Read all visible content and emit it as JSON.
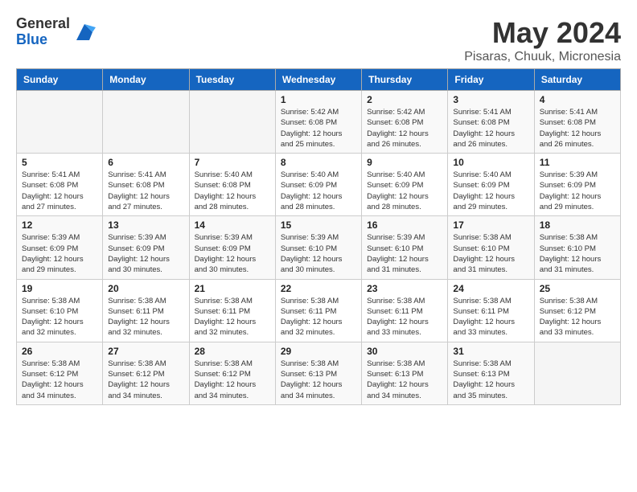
{
  "header": {
    "logo_general": "General",
    "logo_blue": "Blue",
    "month_year": "May 2024",
    "location": "Pisaras, Chuuk, Micronesia"
  },
  "weekdays": [
    "Sunday",
    "Monday",
    "Tuesday",
    "Wednesday",
    "Thursday",
    "Friday",
    "Saturday"
  ],
  "weeks": [
    [
      {
        "day": "",
        "info": ""
      },
      {
        "day": "",
        "info": ""
      },
      {
        "day": "",
        "info": ""
      },
      {
        "day": "1",
        "info": "Sunrise: 5:42 AM\nSunset: 6:08 PM\nDaylight: 12 hours and 25 minutes."
      },
      {
        "day": "2",
        "info": "Sunrise: 5:42 AM\nSunset: 6:08 PM\nDaylight: 12 hours and 26 minutes."
      },
      {
        "day": "3",
        "info": "Sunrise: 5:41 AM\nSunset: 6:08 PM\nDaylight: 12 hours and 26 minutes."
      },
      {
        "day": "4",
        "info": "Sunrise: 5:41 AM\nSunset: 6:08 PM\nDaylight: 12 hours and 26 minutes."
      }
    ],
    [
      {
        "day": "5",
        "info": "Sunrise: 5:41 AM\nSunset: 6:08 PM\nDaylight: 12 hours and 27 minutes."
      },
      {
        "day": "6",
        "info": "Sunrise: 5:41 AM\nSunset: 6:08 PM\nDaylight: 12 hours and 27 minutes."
      },
      {
        "day": "7",
        "info": "Sunrise: 5:40 AM\nSunset: 6:08 PM\nDaylight: 12 hours and 28 minutes."
      },
      {
        "day": "8",
        "info": "Sunrise: 5:40 AM\nSunset: 6:09 PM\nDaylight: 12 hours and 28 minutes."
      },
      {
        "day": "9",
        "info": "Sunrise: 5:40 AM\nSunset: 6:09 PM\nDaylight: 12 hours and 28 minutes."
      },
      {
        "day": "10",
        "info": "Sunrise: 5:40 AM\nSunset: 6:09 PM\nDaylight: 12 hours and 29 minutes."
      },
      {
        "day": "11",
        "info": "Sunrise: 5:39 AM\nSunset: 6:09 PM\nDaylight: 12 hours and 29 minutes."
      }
    ],
    [
      {
        "day": "12",
        "info": "Sunrise: 5:39 AM\nSunset: 6:09 PM\nDaylight: 12 hours and 29 minutes."
      },
      {
        "day": "13",
        "info": "Sunrise: 5:39 AM\nSunset: 6:09 PM\nDaylight: 12 hours and 30 minutes."
      },
      {
        "day": "14",
        "info": "Sunrise: 5:39 AM\nSunset: 6:09 PM\nDaylight: 12 hours and 30 minutes."
      },
      {
        "day": "15",
        "info": "Sunrise: 5:39 AM\nSunset: 6:10 PM\nDaylight: 12 hours and 30 minutes."
      },
      {
        "day": "16",
        "info": "Sunrise: 5:39 AM\nSunset: 6:10 PM\nDaylight: 12 hours and 31 minutes."
      },
      {
        "day": "17",
        "info": "Sunrise: 5:38 AM\nSunset: 6:10 PM\nDaylight: 12 hours and 31 minutes."
      },
      {
        "day": "18",
        "info": "Sunrise: 5:38 AM\nSunset: 6:10 PM\nDaylight: 12 hours and 31 minutes."
      }
    ],
    [
      {
        "day": "19",
        "info": "Sunrise: 5:38 AM\nSunset: 6:10 PM\nDaylight: 12 hours and 32 minutes."
      },
      {
        "day": "20",
        "info": "Sunrise: 5:38 AM\nSunset: 6:11 PM\nDaylight: 12 hours and 32 minutes."
      },
      {
        "day": "21",
        "info": "Sunrise: 5:38 AM\nSunset: 6:11 PM\nDaylight: 12 hours and 32 minutes."
      },
      {
        "day": "22",
        "info": "Sunrise: 5:38 AM\nSunset: 6:11 PM\nDaylight: 12 hours and 32 minutes."
      },
      {
        "day": "23",
        "info": "Sunrise: 5:38 AM\nSunset: 6:11 PM\nDaylight: 12 hours and 33 minutes."
      },
      {
        "day": "24",
        "info": "Sunrise: 5:38 AM\nSunset: 6:11 PM\nDaylight: 12 hours and 33 minutes."
      },
      {
        "day": "25",
        "info": "Sunrise: 5:38 AM\nSunset: 6:12 PM\nDaylight: 12 hours and 33 minutes."
      }
    ],
    [
      {
        "day": "26",
        "info": "Sunrise: 5:38 AM\nSunset: 6:12 PM\nDaylight: 12 hours and 34 minutes."
      },
      {
        "day": "27",
        "info": "Sunrise: 5:38 AM\nSunset: 6:12 PM\nDaylight: 12 hours and 34 minutes."
      },
      {
        "day": "28",
        "info": "Sunrise: 5:38 AM\nSunset: 6:12 PM\nDaylight: 12 hours and 34 minutes."
      },
      {
        "day": "29",
        "info": "Sunrise: 5:38 AM\nSunset: 6:13 PM\nDaylight: 12 hours and 34 minutes."
      },
      {
        "day": "30",
        "info": "Sunrise: 5:38 AM\nSunset: 6:13 PM\nDaylight: 12 hours and 34 minutes."
      },
      {
        "day": "31",
        "info": "Sunrise: 5:38 AM\nSunset: 6:13 PM\nDaylight: 12 hours and 35 minutes."
      },
      {
        "day": "",
        "info": ""
      }
    ]
  ]
}
